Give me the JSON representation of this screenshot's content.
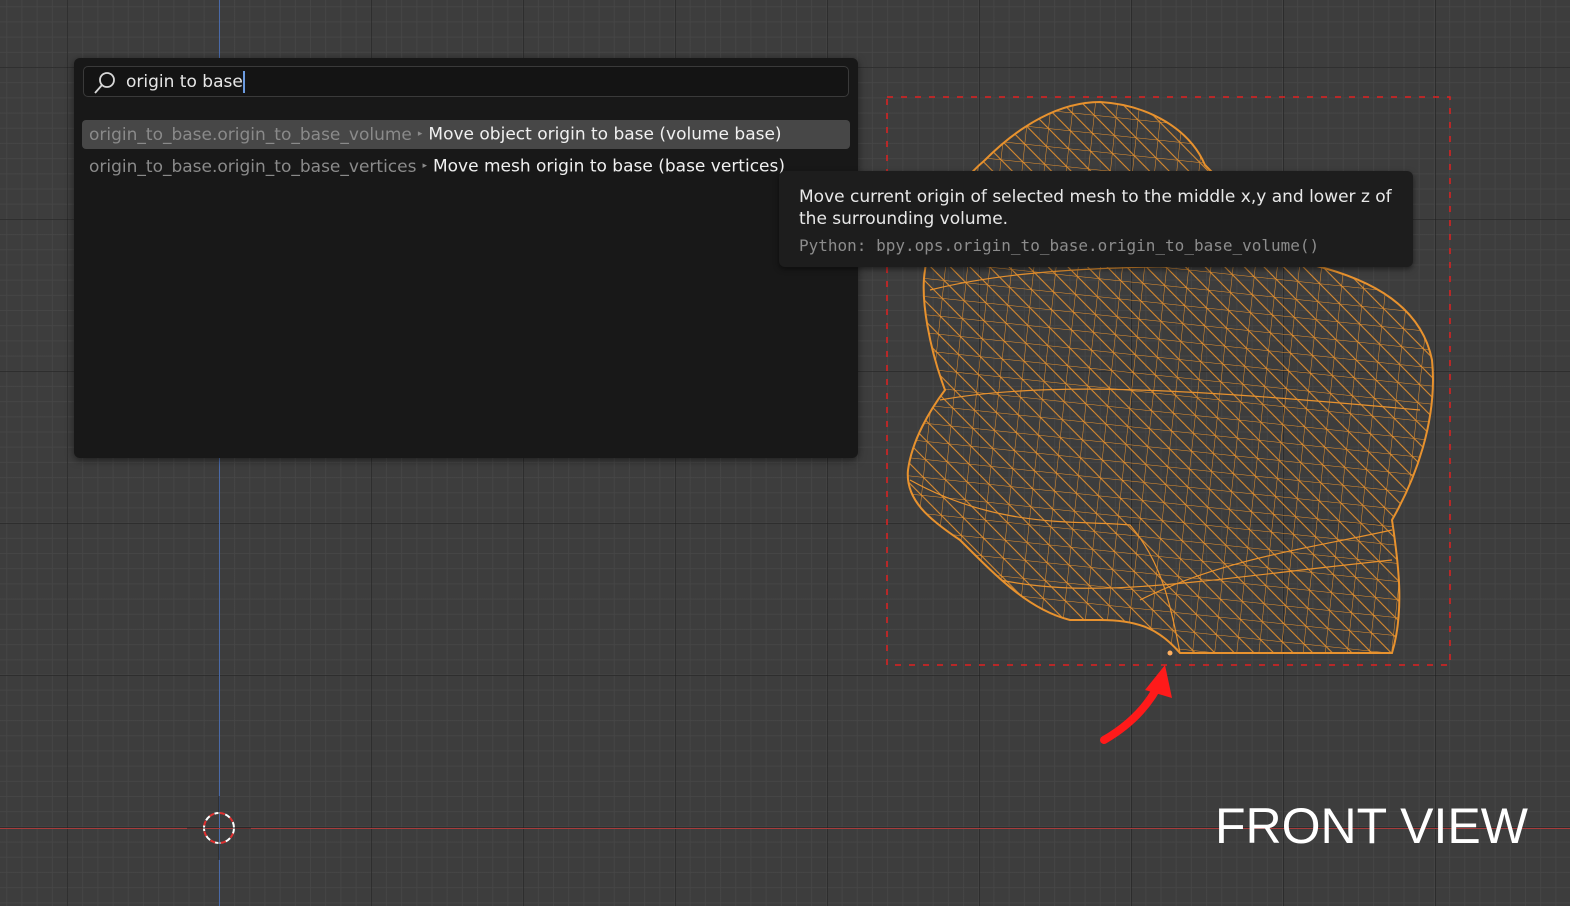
{
  "search": {
    "query": "origin to base",
    "icon": "search-icon"
  },
  "results": [
    {
      "path": "origin_to_base.origin_to_base_volume",
      "description": "Move object origin to base (volume base)",
      "selected": true
    },
    {
      "path": "origin_to_base.origin_to_base_vertices",
      "description": "Move mesh origin to base (base vertices)",
      "selected": false
    }
  ],
  "tooltip": {
    "description": "Move current origin of selected mesh to the middle x,y and lower z of the surrounding volume.",
    "python": "Python: bpy.ops.origin_to_base.origin_to_base_volume()"
  },
  "annotation": {
    "label": "FRONT VIEW"
  },
  "colors": {
    "wireframe": "#e8922e",
    "bounds": "#e02020",
    "arrow": "#ff1a1a"
  }
}
